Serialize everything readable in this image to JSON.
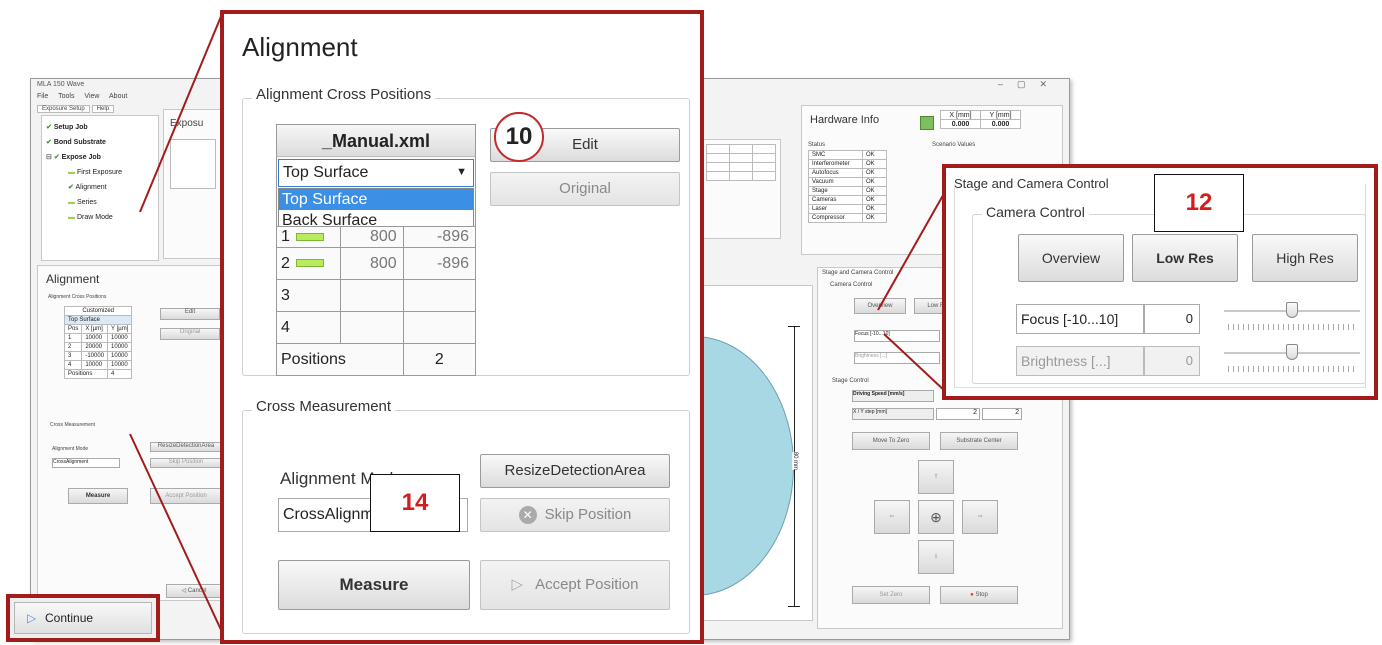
{
  "bg": {
    "title": "MLA 150 Wave",
    "menu": [
      "File",
      "Tools",
      "View",
      "About"
    ],
    "tabs": [
      "Exposure Setup",
      "Help"
    ],
    "steps": [
      {
        "icon": "check",
        "label": "Setup Job"
      },
      {
        "icon": "check",
        "label": "Bond Substrate"
      },
      {
        "icon": "check",
        "label": "Expose Job"
      },
      {
        "icon": "dash",
        "label": "First Exposure"
      },
      {
        "icon": "check",
        "label": "Alignment"
      },
      {
        "icon": "dash",
        "label": "Series"
      },
      {
        "icon": "dash",
        "label": "Draw Mode"
      }
    ],
    "exposure_title": "Exposu",
    "hardware": {
      "title": "Hardware Info",
      "x_label": "X [mm]",
      "y_label": "Y [mm]",
      "x_value": "0.000",
      "y_value": "0.000",
      "status_label": "Status",
      "status_rows": [
        [
          "SMC",
          "OK"
        ],
        [
          "Interferometer",
          "OK"
        ],
        [
          "Autofocus",
          "OK"
        ],
        [
          "Vacuum",
          "OK"
        ],
        [
          "Stage",
          "OK"
        ],
        [
          "Cameras",
          "OK"
        ],
        [
          "Laser",
          "OK"
        ],
        [
          "Compressor",
          "OK"
        ]
      ],
      "scenario_label": "Scenario Values"
    },
    "small_alignment": {
      "title": "Alignment",
      "cross_label": "Alignment Cross Positions",
      "file": "Customized",
      "surface": "Top Surface",
      "headers": [
        "Pos",
        "X [µm]",
        "Y [µm]"
      ],
      "edit": "Edit",
      "original": "Original",
      "positions": "Positions",
      "cross_meas": "Cross Measurement",
      "mode_label": "Alignment Mode",
      "mode_value": "CrossAlignment",
      "resize": "ResizeDetectionArea",
      "skip": "Skip Position",
      "measure": "Measure",
      "accept": "Accept Position",
      "cancel": "Cancel"
    },
    "stage_small": {
      "title": "Stage and Camera Control",
      "camera": "Camera Control",
      "overview": "Overview",
      "lowres": "Low Res",
      "focus": "Focus [-10...10]",
      "brightness": "Brightness [...]",
      "stage_control": "Stage Control",
      "speed": "Driving Speed [mm/s]",
      "xy_step": "X / Y step [mm]",
      "step_x": "2",
      "step_y": "2",
      "move_zero": "Move To Zero",
      "substrate_center": "Substrate Center",
      "set_zero": "Set Zero",
      "stop": "Stop"
    },
    "scale_label": "80 mm"
  },
  "alignment": {
    "title": "Alignment",
    "cross_group": "Alignment Cross Positions",
    "file_name": "_Manual.xml",
    "surface_selected": "Top Surface",
    "dropdown_options": [
      "Top Surface",
      "Back Surface"
    ],
    "rows": [
      {
        "pos": "1",
        "x": "800",
        "y": "-896"
      },
      {
        "pos": "2",
        "x": "800",
        "y": "-896"
      },
      {
        "pos": "3",
        "x": "",
        "y": ""
      },
      {
        "pos": "4",
        "x": "",
        "y": ""
      }
    ],
    "positions_label": "Positions",
    "positions_value": "2",
    "badge_10": "10",
    "edit": "Edit",
    "original": "Original",
    "cross_meas_group": "Cross Measurement",
    "mode_label": "Alignment Mode",
    "mode_value": "CrossAlignm",
    "badge_14": "14",
    "resize": "ResizeDetectionArea",
    "skip": "Skip Position",
    "measure": "Measure",
    "accept": "Accept Position"
  },
  "stage_callout": {
    "title": "Stage and Camera Control",
    "badge_12": "12",
    "camera_group": "Camera Control",
    "overview": "Overview",
    "lowres": "Low Res",
    "highres": "High Res",
    "focus_label": "Focus [-10...10]",
    "focus_value": "0",
    "brightness_label": "Brightness [...]",
    "brightness_value": "0"
  },
  "continue": {
    "label": "Continue"
  }
}
